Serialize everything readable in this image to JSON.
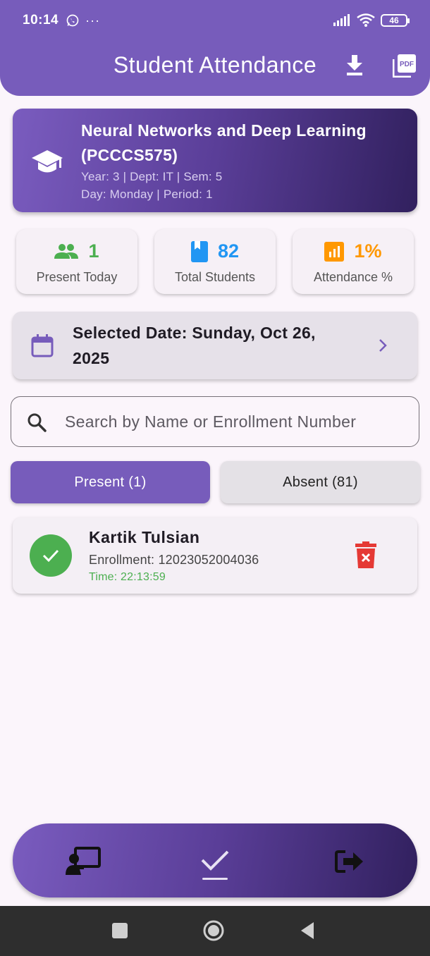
{
  "status_bar": {
    "time": "10:14",
    "more": "···",
    "battery": "46"
  },
  "header": {
    "title": "Student Attendance",
    "download_icon": "download-icon",
    "pdf_icon": "pdf-icon",
    "pdf_label": "PDF",
    "color": "#775cbb"
  },
  "course": {
    "name": "Neural Networks and Deep Learning (PCCCS575)",
    "meta_line1": "Year: 3 | Dept: IT | Sem: 5",
    "meta_line2": "Day: Monday | Period: 1",
    "icon": "graduation-cap-icon"
  },
  "stats": [
    {
      "icon": "people-icon",
      "value": "1",
      "label": "Present Today",
      "color": "#4caf50"
    },
    {
      "icon": "book-icon",
      "value": "82",
      "label": "Total Students",
      "color": "#2196f3"
    },
    {
      "icon": "bar-chart-icon",
      "value": "1%",
      "label": "Attendance %",
      "color": "#ff9800"
    }
  ],
  "date_selector": {
    "text": "Selected Date: Sunday, Oct 26, 2025",
    "icon": "calendar-icon",
    "chevron": "chevron-right-icon"
  },
  "search": {
    "placeholder": "Search by Name or Enrollment Number",
    "value": ""
  },
  "tabs": {
    "present": "Present (1)",
    "absent": "Absent (81)",
    "selected": "present"
  },
  "students": [
    {
      "name": "Kartik Tulsian",
      "enrollment": "Enrollment: 12023052004036",
      "time": "Time: 22:13:59",
      "status_color": "#4caf50"
    }
  ],
  "bottom_nav": {
    "items": [
      "teacher-icon",
      "check-icon",
      "logout-icon"
    ],
    "selected": "check-icon"
  },
  "colors": {
    "accent": "#775cbb",
    "present_green": "#4caf50",
    "delete_red": "#e53935"
  }
}
